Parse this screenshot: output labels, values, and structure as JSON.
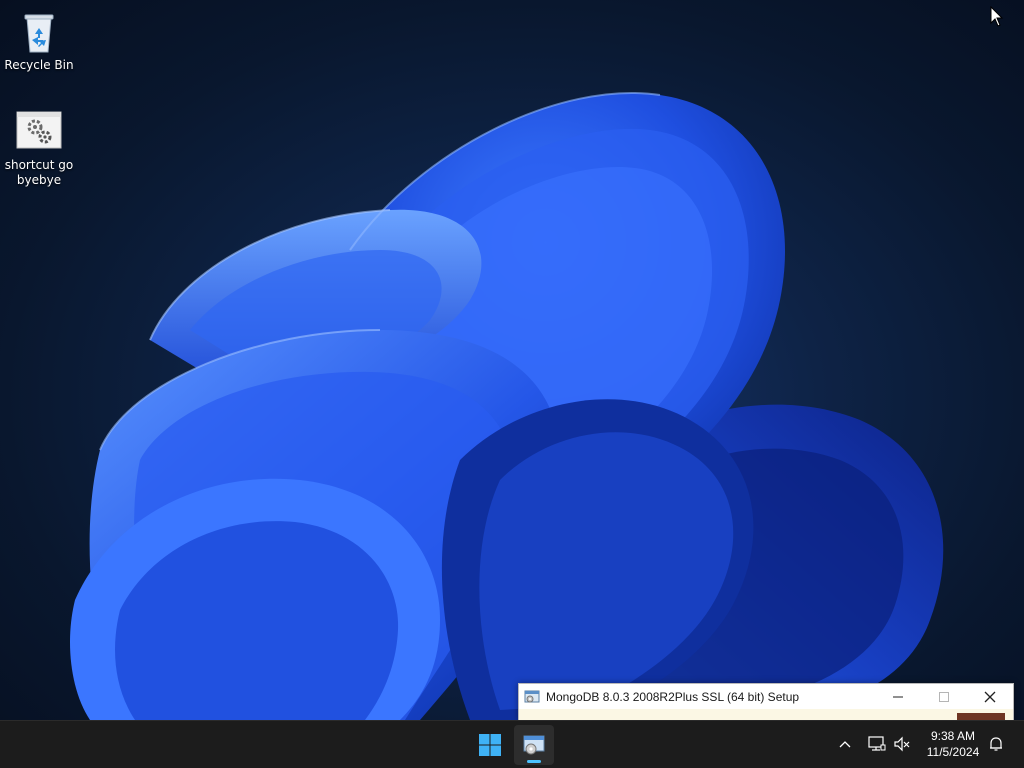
{
  "desktop": {
    "icons": [
      {
        "label": "Recycle Bin",
        "icon": "recycle-bin-icon"
      },
      {
        "label": "shortcut go byebye",
        "icon": "gear-shortcut-icon"
      }
    ]
  },
  "setup_window": {
    "title": "MongoDB 8.0.3 2008R2Plus SSL (64 bit) Setup",
    "icon": "installer-icon",
    "controls": [
      "minimize-icon",
      "maximize-icon",
      "close-icon"
    ]
  },
  "taskbar": {
    "start_icon": "windows-start-icon",
    "pinned": [
      {
        "icon": "installer-icon",
        "active": true
      }
    ],
    "tray": {
      "icons": [
        "chevron-up-icon",
        "network-icon",
        "volume-muted-icon",
        "notification-bell-icon"
      ],
      "time": "9:38 AM",
      "date": "11/5/2024"
    },
    "accent_color": "#4cc2ff"
  }
}
